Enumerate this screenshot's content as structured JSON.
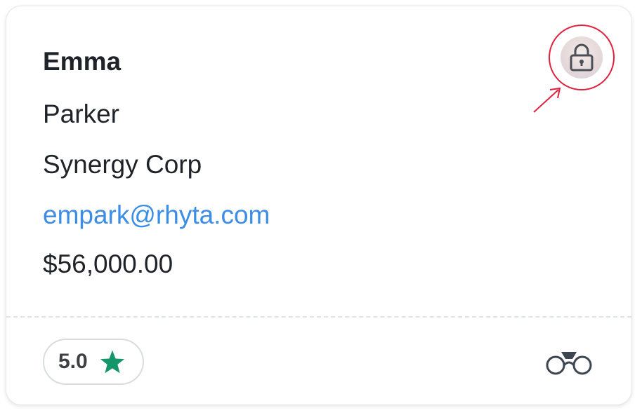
{
  "contact": {
    "first_name": "Emma",
    "last_name": "Parker",
    "company": "Synergy Corp",
    "email": "empark@rhyta.com",
    "amount": "$56,000.00"
  },
  "rating": {
    "value": "5.0",
    "icon": "star-icon",
    "star_color": "#15956a"
  },
  "avatar": {
    "overlay_icon": "lock-icon",
    "highlight_color": "#e0203c"
  },
  "footer": {
    "action_icon": "binoculars-icon"
  },
  "colors": {
    "link": "#3b8de6",
    "text": "#1f2328"
  }
}
